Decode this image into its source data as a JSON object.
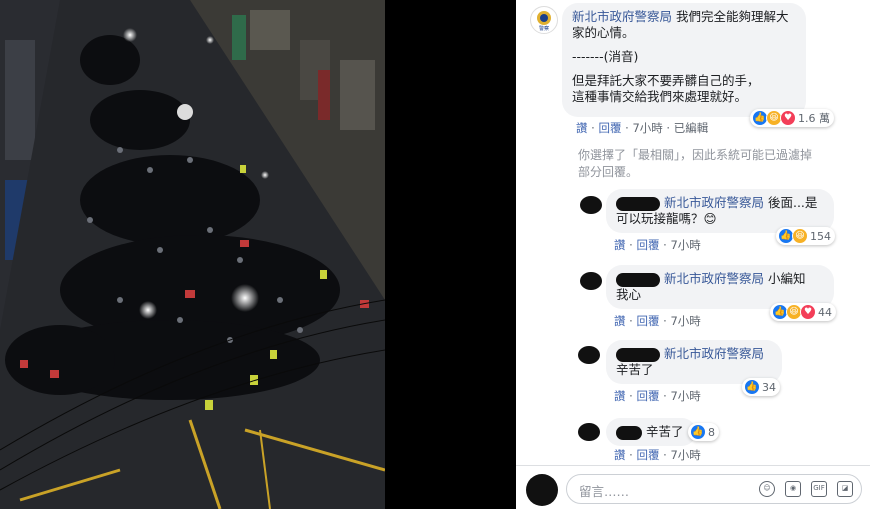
{
  "photo": {
    "alt": "night street crowd photo"
  },
  "comments": [
    {
      "author": "新北市政府警察局",
      "line1": "我們完全能夠理解大",
      "line2": "家的心情。",
      "line3": "-------(消音)",
      "line4": "但是拜託大家不要弄髒自己的手，",
      "line5": "這種事情交給我們來處理就好。",
      "reactions": "1.6 萬",
      "act_like": "讚",
      "act_reply": "回覆",
      "time": "7小時",
      "edited": "已編輯"
    },
    {
      "author": "新北市政府警察局",
      "line1": "後面...是",
      "line2": "可以玩接龍嗎？",
      "emoji": "😊",
      "reactions": "154",
      "act_like": "讚",
      "act_reply": "回覆",
      "time": "7小時"
    },
    {
      "author": "新北市政府警察局",
      "line1": "小編知",
      "line2": "我心",
      "reactions": "44",
      "act_like": "讚",
      "act_reply": "回覆",
      "time": "7小時"
    },
    {
      "author": "新北市政府警察局",
      "line1": "辛苦了",
      "reactions": "34",
      "act_like": "讚",
      "act_reply": "回覆",
      "time": "7小時"
    },
    {
      "line1": "辛苦了",
      "reactions": "8",
      "act_like": "讚",
      "act_reply": "回覆",
      "time": "7小時"
    }
  ],
  "filter_note": {
    "line1": "你選擇了「最相關」，因此系統可能已過濾掉",
    "line2": "部分回覆。"
  },
  "composer": {
    "placeholder": "留言……"
  },
  "police_badge_text": "警察",
  "icons": [
    "emoji-icon",
    "camera-icon",
    "gif-icon",
    "sticker-icon"
  ]
}
